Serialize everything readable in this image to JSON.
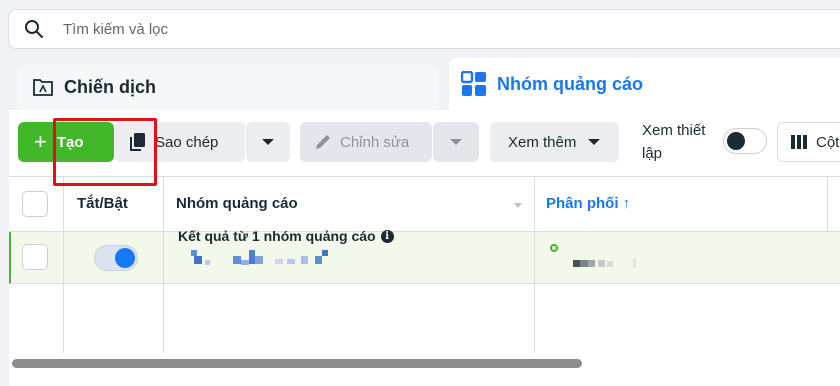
{
  "search": {
    "placeholder": "Tìm kiếm và lọc"
  },
  "tabs": [
    {
      "label": "Chiến dịch",
      "icon": "campaign-folder-icon"
    },
    {
      "label": "Nhóm quảng cáo",
      "icon": "adset-grid-icon"
    }
  ],
  "toolbar": {
    "create_label": "Tạo",
    "copy_label": "Sao chép",
    "edit_label": "Chỉnh sửa",
    "more_label": "Xem thêm",
    "view_setup_label": "Xem thiết lập",
    "columns_label": "Cột"
  },
  "table": {
    "headers": [
      "Tắt/Bật",
      "Nhóm quảng cáo",
      "Phân phối ↑"
    ],
    "rows": [
      {
        "toggle_on": true,
        "name": "",
        "delivery": ""
      }
    ],
    "summary": "Kết quả từ 1 nhóm quảng cáo"
  },
  "colors": {
    "accent": "#1877f2",
    "create_green": "#42b72a",
    "highlight_red": "#e1111a"
  }
}
